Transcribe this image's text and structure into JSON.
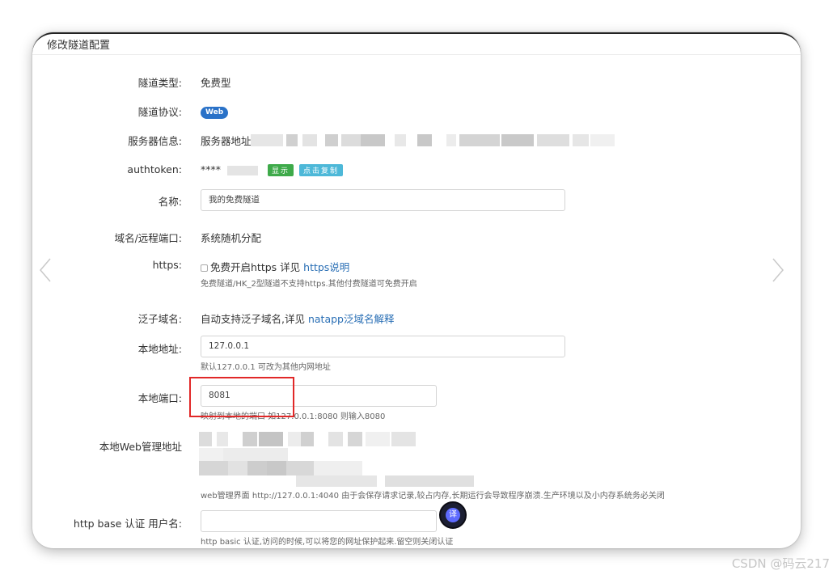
{
  "panel": {
    "title": "修改隧道配置"
  },
  "fields": {
    "tunnel_type": {
      "label": "隧道类型:",
      "value": "免费型"
    },
    "tunnel_protocol": {
      "label": "隧道协议:",
      "badge": "Web"
    },
    "server_info": {
      "label": "服务器信息:",
      "value": "服务器地址:"
    },
    "authtoken": {
      "label": "authtoken:",
      "masked": "****",
      "show_label": "显示",
      "copy_label": "点击复制"
    },
    "name": {
      "label": "名称:",
      "value": "我的免费隧道"
    },
    "domain_port": {
      "label": "域名/远程端口:",
      "value": "系统随机分配"
    },
    "https": {
      "label": "https:",
      "checkbox_label": "免费开启https 详见",
      "link": "https说明",
      "hint": "免费隧道/HK_2型隧道不支持https.其他付费隧道可免费开启"
    },
    "wildcard": {
      "label": "泛子域名:",
      "value": "自动支持泛子域名,详见",
      "link": "natapp泛域名解释"
    },
    "local_addr": {
      "label": "本地地址:",
      "value": "127.0.0.1",
      "hint": "默认127.0.0.1 可改为其他内网地址"
    },
    "local_port": {
      "label": "本地端口:",
      "value": "8081",
      "hint": "映射到本地的端口 如127.0.0.1:8080 则输入8080"
    },
    "web_admin": {
      "label": "本地Web管理地址",
      "hint": "web管理界面 http://127.0.0.1:4040 由于会保存请求记录,较占内存,长期运行会导致程序崩溃.生产环境以及小内存系统务必关闭"
    },
    "http_auth_user": {
      "label": "http base 认证 用户名:",
      "value": "",
      "hint": "http basic 认证,访问的时候,可以将您的网址保护起来.留空则关闭认证"
    }
  },
  "translate_button": {
    "label": "译"
  },
  "watermark": "CSDN @码云217",
  "colors": {
    "accent": "#2a6fb5",
    "highlight_box": "#e12828",
    "badge_web": "#2a72c8",
    "btn_show": "#3eaa4a",
    "btn_copy": "#4db8d8"
  },
  "icons": {
    "prev": "chevron-left-icon",
    "next": "chevron-right-icon",
    "translate": "translate-icon"
  }
}
